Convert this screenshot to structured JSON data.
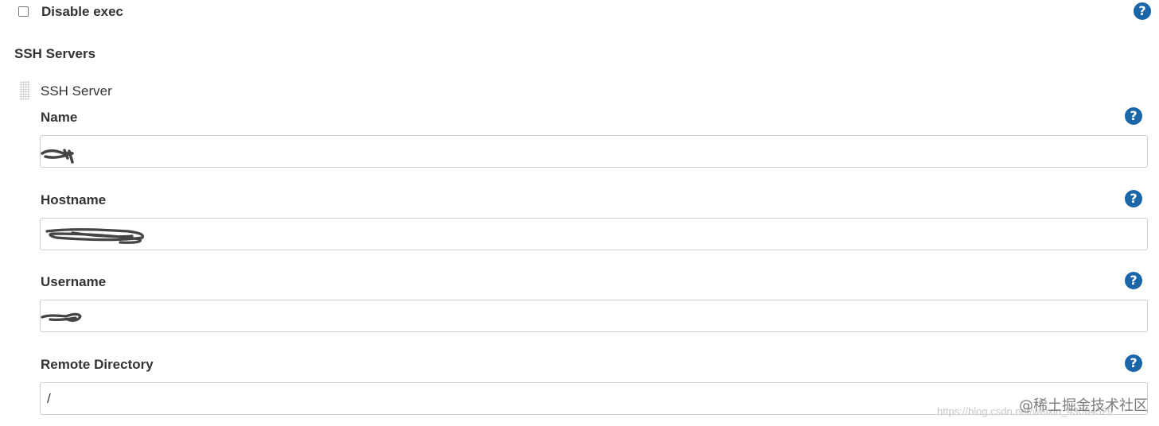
{
  "disable_exec": {
    "label": "Disable exec",
    "checked": false
  },
  "section": {
    "title": "SSH Servers"
  },
  "server": {
    "header": "SSH Server",
    "fields": [
      {
        "label": "Name",
        "value": "",
        "redacted": true
      },
      {
        "label": "Hostname",
        "value": "",
        "redacted": true
      },
      {
        "label": "Username",
        "value": "",
        "redacted": true
      },
      {
        "label": "Remote Directory",
        "value": "/"
      }
    ]
  },
  "icons": {
    "help": "question-circle-icon",
    "drag": "drag-handle-icon"
  },
  "help_glyph": "?",
  "colors": {
    "help": "#1a66a8",
    "border": "#cfcfcf",
    "text": "#333333"
  },
  "watermark": {
    "brand": "@稀土掘金技术社区",
    "url": "https://blog.csdn.net/weixin_43064529"
  }
}
